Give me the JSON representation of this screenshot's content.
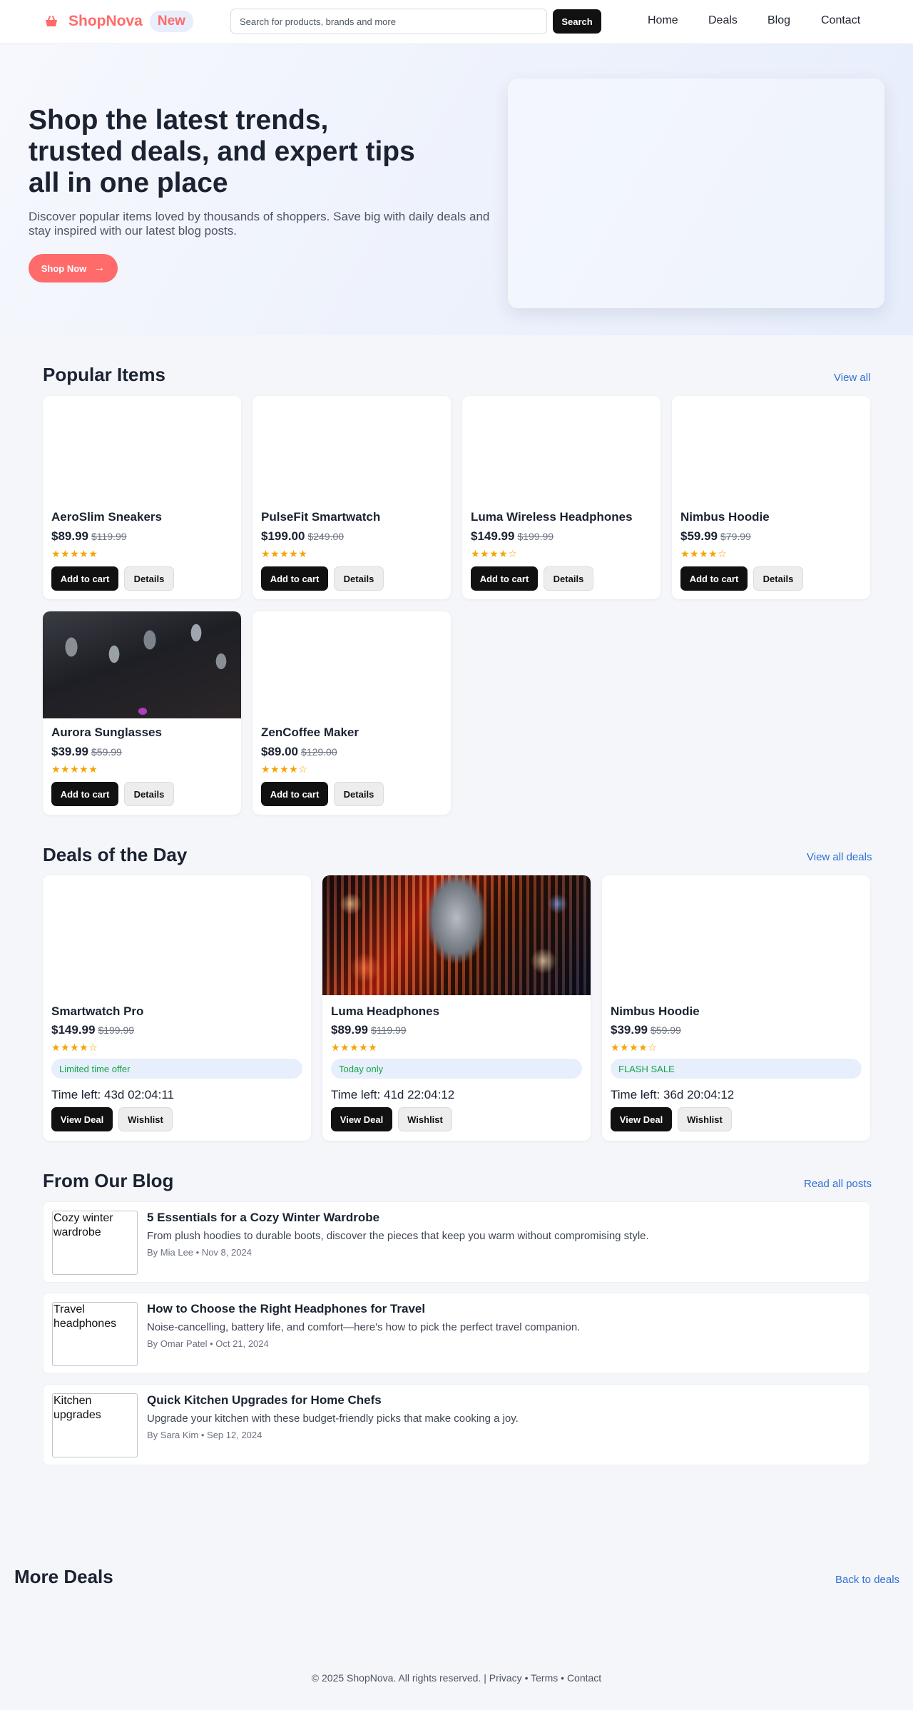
{
  "header": {
    "brand": "ShopNova",
    "badge": "New",
    "search_placeholder": "Search for products, brands and more",
    "search_button": "Search",
    "nav": [
      "Home",
      "Deals",
      "Blog",
      "Contact"
    ]
  },
  "hero": {
    "title": "Shop the latest trends, trusted deals, and expert tips all in one place",
    "subtitle": "Discover popular items loved by thousands of shoppers. Save big with daily deals and stay inspired with our latest blog posts.",
    "cta": "Shop Now",
    "cta_arrow": "→"
  },
  "popular": {
    "title": "Popular Items",
    "view_all": "View all",
    "items": [
      {
        "name": "AeroSlim Sneakers",
        "price": "$89.99",
        "old_price": "$119.99",
        "stars": "★★★★★",
        "rating": 5,
        "add": "Add to cart",
        "details": "Details"
      },
      {
        "name": "PulseFit Smartwatch",
        "price": "$199.00",
        "old_price": "$249.00",
        "stars": "★★★★★",
        "rating": 5,
        "add": "Add to cart",
        "details": "Details"
      },
      {
        "name": "Luma Wireless Headphones",
        "price": "$149.99",
        "old_price": "$199.99",
        "stars": "★★★★☆",
        "rating": 4,
        "add": "Add to cart",
        "details": "Details"
      },
      {
        "name": "Nimbus Hoodie",
        "price": "$59.99",
        "old_price": "$79.99",
        "stars": "★★★★☆",
        "rating": 4,
        "add": "Add to cart",
        "details": "Details"
      },
      {
        "name": "Aurora Sunglasses",
        "price": "$39.99",
        "old_price": "$59.99",
        "stars": "★★★★★",
        "rating": 5,
        "add": "Add to cart",
        "details": "Details"
      },
      {
        "name": "ZenCoffee Maker",
        "price": "$89.00",
        "old_price": "$129.00",
        "stars": "★★★★☆",
        "rating": 4,
        "add": "Add to cart",
        "details": "Details"
      }
    ]
  },
  "deals": {
    "title": "Deals of the Day",
    "view_all": "View all deals",
    "items": [
      {
        "name": "Smartwatch Pro",
        "price": "$149.99",
        "old_price": "$199.99",
        "stars": "★★★★☆",
        "rating": 4,
        "badge": "Limited time offer",
        "time_left": "Time left: 43d 02:04:11",
        "view": "View Deal",
        "wishlist": "Wishlist"
      },
      {
        "name": "Luma Headphones",
        "price": "$89.99",
        "old_price": "$119.99",
        "stars": "★★★★★",
        "rating": 5,
        "badge": "Today only",
        "time_left": "Time left: 41d 22:04:12",
        "view": "View Deal",
        "wishlist": "Wishlist"
      },
      {
        "name": "Nimbus Hoodie",
        "price": "$39.99",
        "old_price": "$59.99",
        "stars": "★★★★☆",
        "rating": 4,
        "badge": "FLASH SALE",
        "time_left": "Time left: 36d 20:04:12",
        "view": "View Deal",
        "wishlist": "Wishlist"
      }
    ]
  },
  "blog": {
    "title": "From Our Blog",
    "read_all": "Read all posts",
    "posts": [
      {
        "alt": "Cozy winter wardrobe",
        "title": "5 Essentials for a Cozy Winter Wardrobe",
        "desc": "From plush hoodies to durable boots, discover the pieces that keep you warm without compromising style.",
        "meta": "By Mia Lee • Nov 8, 2024"
      },
      {
        "alt": "Travel headphones",
        "title": "How to Choose the Right Headphones for Travel",
        "desc": "Noise-cancelling, battery life, and comfort—here's how to pick the perfect travel companion.",
        "meta": "By Omar Patel • Oct 21, 2024"
      },
      {
        "alt": "Kitchen upgrades",
        "title": "Quick Kitchen Upgrades for Home Chefs",
        "desc": "Upgrade your kitchen with these budget-friendly picks that make cooking a joy.",
        "meta": "By Sara Kim • Sep 12, 2024"
      }
    ]
  },
  "more_deals": {
    "title": "More Deals",
    "back": "Back to deals"
  },
  "footer": {
    "copyright": "© 2025 ShopNova. All rights reserved. | ",
    "links": [
      "Privacy",
      "Terms",
      "Contact"
    ],
    "sep": " • "
  },
  "colors": {
    "brand": "#ff6b6b",
    "link": "#2f6fd6",
    "star": "#f5a400",
    "badge_text": "#16a34a"
  }
}
